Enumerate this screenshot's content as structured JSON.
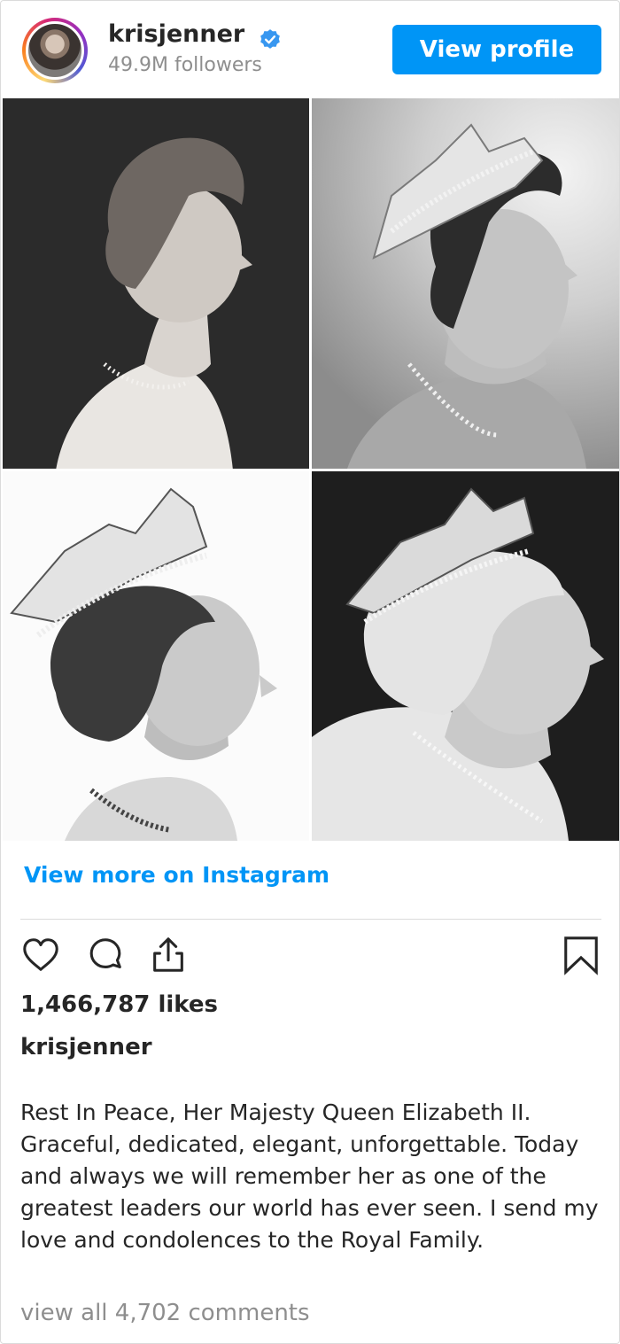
{
  "header": {
    "username": "krisjenner",
    "followers": "49.9M followers",
    "view_profile_label": "View profile"
  },
  "post": {
    "photos": [
      {
        "icon": "portrait-photo"
      },
      {
        "icon": "portrait-photo"
      },
      {
        "icon": "portrait-photo"
      },
      {
        "icon": "portrait-photo"
      }
    ],
    "view_more_label": "View more on Instagram",
    "likes": "1,466,787 likes",
    "author": "krisjenner",
    "caption": "Rest In Peace, Her Majesty Queen Elizabeth II. Graceful, dedicated, elegant, unforgettable. Today and always we will remember her as one of the greatest leaders our world has ever seen. I send my love and condolences to the Royal Family.",
    "view_comments": "view all 4,702 comments"
  },
  "icons": {
    "verified": "verified-badge-icon",
    "like": "heart-icon",
    "comment": "comment-icon",
    "share": "share-icon",
    "save": "bookmark-icon"
  },
  "colors": {
    "accent": "#0095f6",
    "text": "#262626",
    "muted": "#8e8e8e",
    "divider": "#dbdbdb"
  }
}
